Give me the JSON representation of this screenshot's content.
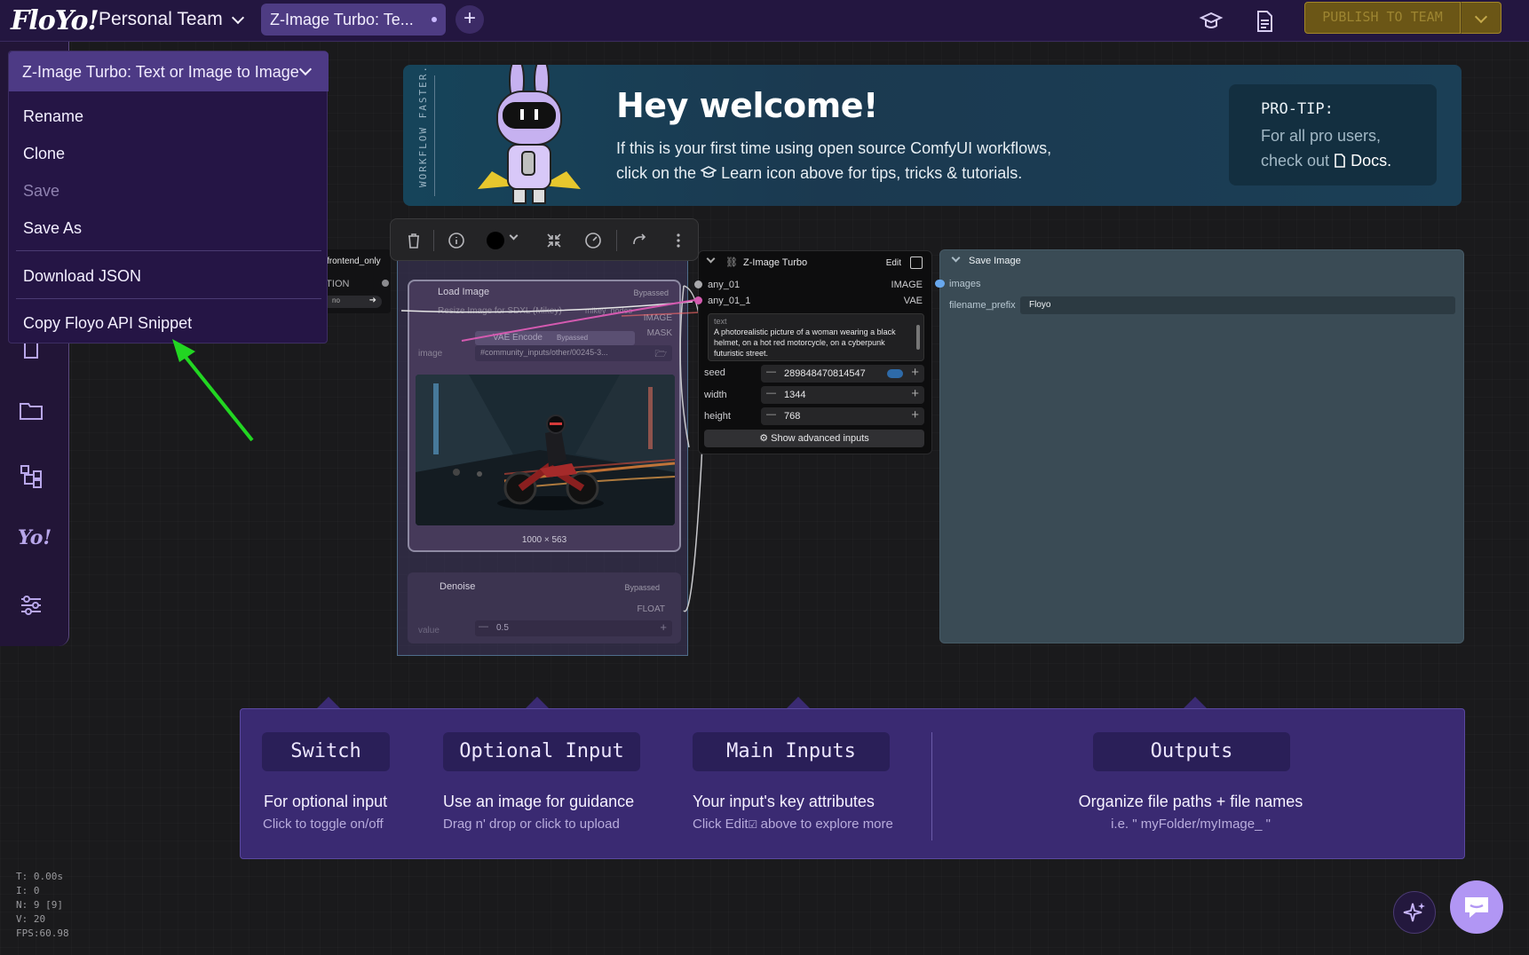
{
  "topbar": {
    "logo": "FloYo!",
    "team": "Personal Team",
    "tab_label": "Z-Image Turbo: Te...",
    "new_tab": "+",
    "publish_label": "PUBLISH TO TEAM"
  },
  "menu": {
    "title": "Z-Image Turbo: Text or Image to Image",
    "items": [
      "Rename",
      "Clone",
      "Save",
      "Save As",
      "Download JSON",
      "Copy Floyo API Snippet"
    ]
  },
  "banner": {
    "vertical": "WORKFLOW FASTER.",
    "heading": "Hey welcome!",
    "line1": "If this is your first time using open source ComfyUI workflows,",
    "line2_a": "click on the",
    "line2_b": "Learn icon above for tips, tricks & tutorials.",
    "protip_title": "PRO-TIP:",
    "protip_l1": "For all pro users,",
    "protip_l2": "check out",
    "protip_link": "Docs."
  },
  "nodes": {
    "frontend_only": "frontend_only",
    "connection": "NNECTION",
    "no_label": "no",
    "load_image": {
      "title": "Load Image",
      "bypassed": "Bypassed",
      "resize_text": "Resize Image for SDXL (Mikey)",
      "mikey_nodes": "mikey_nodes",
      "image_out": "IMAGE",
      "mask_out": "MASK",
      "vae_encode": "VAE Encode",
      "vae_bypassed": "Bypassed",
      "image_label": "image",
      "image_path": "#community_inputs/other/00245-3...",
      "dims": "1000 × 563"
    },
    "denoise": {
      "title": "Denoise",
      "bypassed": "Bypassed",
      "float_out": "FLOAT",
      "value_label": "value",
      "value": "0.5"
    },
    "zimage": {
      "title": "Z-Image Turbo",
      "edit": "Edit",
      "in1": "any_01",
      "in2": "any_01_1",
      "out1": "IMAGE",
      "out2": "VAE",
      "text_label": "text",
      "text_value": "A photorealistic picture of a woman wearing a black helmet, on a hot red motorcycle, on a cyberpunk futuristic street.",
      "seed_label": "seed",
      "seed": "289848470814547",
      "width_label": "width",
      "width": "1344",
      "height_label": "height",
      "height": "768",
      "advanced": "Show advanced inputs"
    },
    "save_image": {
      "title": "Save Image",
      "in": "images",
      "prefix_label": "filename_prefix",
      "prefix": "Floyo"
    }
  },
  "legend": {
    "switch_btn": "Switch",
    "switch_title": "For optional input",
    "switch_sub": "Click to toggle on/off",
    "optional_btn": "Optional Input",
    "optional_title": "Use an image for guidance",
    "optional_sub": "Drag n' drop or click to upload",
    "main_btn": "Main Inputs",
    "main_title": "Your input's key attributes",
    "main_sub_a": "Click Edit",
    "main_sub_b": "above to explore more",
    "outputs_btn": "Outputs",
    "outputs_title": "Organize file paths + file names",
    "outputs_sub": "i.e. \" myFolder/myImage_ \""
  },
  "stats": [
    "T: 0.00s",
    "I: 0",
    "N: 9 [9]",
    "V: 20",
    "FPS:60.98"
  ],
  "colors": {
    "topbar": "#231640",
    "accent": "#4d3a85",
    "publish": "#6b5616",
    "banner": "#16445a",
    "legend": "#3a2a72",
    "arrow": "#22d622"
  }
}
